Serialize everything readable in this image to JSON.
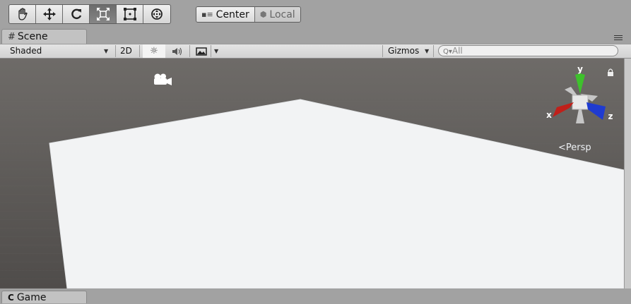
{
  "toolbar": {
    "tools": [
      {
        "name": "hand-tool",
        "icon": "hand-icon",
        "active": false
      },
      {
        "name": "move-tool",
        "icon": "move-arrows-icon",
        "active": false
      },
      {
        "name": "rotate-tool",
        "icon": "rotate-icon",
        "active": false
      },
      {
        "name": "scale-tool",
        "icon": "scale-icon",
        "active": true
      },
      {
        "name": "rect-tool",
        "icon": "rect-transform-icon",
        "active": false
      },
      {
        "name": "transform-tool",
        "icon": "transform-icon",
        "active": false
      }
    ],
    "pivot_label": "Center",
    "pivot_icon": "pivot-center-icon",
    "space_label": "Local",
    "space_icon": "local-space-icon"
  },
  "scene_tab": {
    "label": "Scene",
    "icon": "scene-grid-icon"
  },
  "scene_controls": {
    "shading_mode": "Shaded",
    "mode_2d": "2D",
    "lighting_icon": "sun-icon",
    "audio_icon": "speaker-icon",
    "effects_icon": "image-effects-icon",
    "gizmos_label": "Gizmos",
    "search_placeholder": "All"
  },
  "viewport": {
    "background_color": "#5f5c5a",
    "plane_color": "#f2f3f4",
    "camera_icon": "camera-icon",
    "gizmo": {
      "y_label": "y",
      "x_label": "x",
      "z_label": "z",
      "y_color": "#3ec12c",
      "x_color": "#c0201a",
      "z_color": "#1f3bd0",
      "projection_label": "Persp",
      "lock_icon": "lock-icon"
    }
  },
  "game_tab": {
    "label": "Game",
    "icon": "game-controller-icon"
  }
}
